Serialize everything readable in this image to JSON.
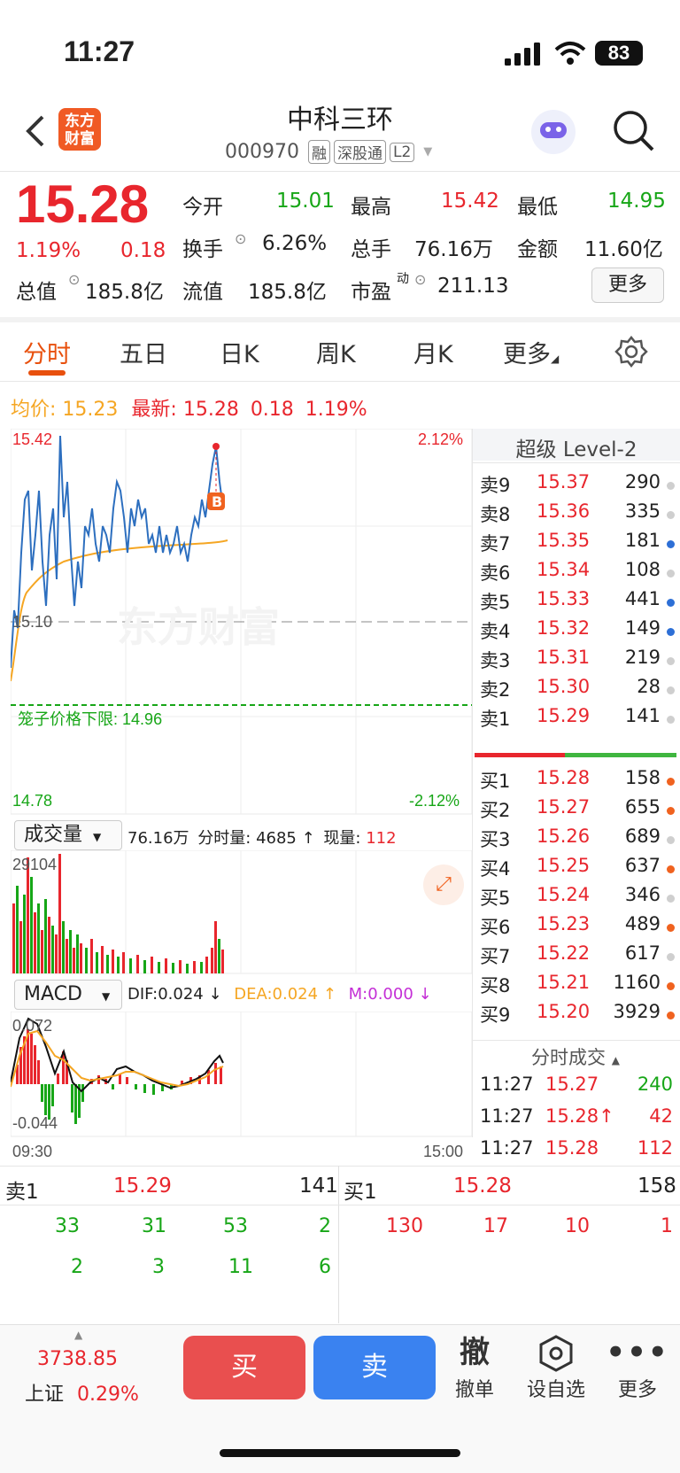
{
  "status": {
    "time": "11:27",
    "battery": "83"
  },
  "header": {
    "title": "中科三环",
    "code": "000970",
    "tags": [
      "融",
      "深股通",
      "L2"
    ],
    "logo": "东方\n财富"
  },
  "quote": {
    "price": "15.28",
    "pct": "1.19%",
    "chg": "0.18",
    "open_label": "今开",
    "open": "15.01",
    "high_label": "最高",
    "high": "15.42",
    "low_label": "最低",
    "low": "14.95",
    "turnover_label": "换手",
    "turnover": "6.26%",
    "volume_label": "总手",
    "volume": "76.16万",
    "amount_label": "金额",
    "amount": "11.60亿",
    "mktcap_label": "总值",
    "mktcap": "185.8亿",
    "float_label": "流值",
    "float": "185.8亿",
    "pe_label": "市盈",
    "pe_sup": "动",
    "pe": "211.13",
    "more": "更多"
  },
  "tabs": [
    "分时",
    "五日",
    "日K",
    "周K",
    "月K",
    "更多"
  ],
  "info": {
    "avg_label": "均价:",
    "avg": "15.23",
    "latest_label": "最新:",
    "latest": "15.28",
    "chg": "0.18",
    "pct": "1.19%"
  },
  "chart": {
    "top_price": "15.42",
    "bottom_price": "14.78",
    "top_pct": "2.12%",
    "bottom_pct": "-2.12%",
    "mid_price": "15.10",
    "watermark": "东方财富",
    "limit_label": "笼子价格下限:",
    "limit_value": "14.96",
    "marker": "B",
    "time_start": "09:30",
    "time_end": "15:00"
  },
  "volume": {
    "selector": "成交量",
    "total": "76.16万",
    "tick_label": "分时量:",
    "tick": "4685",
    "now_label": "现量:",
    "now": "112",
    "max": "29104"
  },
  "macd": {
    "selector": "MACD",
    "dif": "DIF:0.024 ↓",
    "dea": "DEA:0.024 ↑",
    "m": "M:0.000 ↓",
    "top": "0.072",
    "bottom": "-0.044"
  },
  "orderbook": {
    "title": "超级 Level-2",
    "asks": [
      {
        "label": "卖9",
        "price": "15.37",
        "vol": "290",
        "dot": "#cfcfcf"
      },
      {
        "label": "卖8",
        "price": "15.36",
        "vol": "335",
        "dot": "#cfcfcf"
      },
      {
        "label": "卖7",
        "price": "15.35",
        "vol": "181",
        "dot": "#2d6fd6"
      },
      {
        "label": "卖6",
        "price": "15.34",
        "vol": "108",
        "dot": "#cfcfcf"
      },
      {
        "label": "卖5",
        "price": "15.33",
        "vol": "441",
        "dot": "#2d6fd6"
      },
      {
        "label": "卖4",
        "price": "15.32",
        "vol": "149",
        "dot": "#2d6fd6"
      },
      {
        "label": "卖3",
        "price": "15.31",
        "vol": "219",
        "dot": "#cfcfcf"
      },
      {
        "label": "卖2",
        "price": "15.30",
        "vol": "28",
        "dot": "#cfcfcf"
      },
      {
        "label": "卖1",
        "price": "15.29",
        "vol": "141",
        "dot": "#cfcfcf"
      }
    ],
    "bids": [
      {
        "label": "买1",
        "price": "15.28",
        "vol": "158",
        "dot": "#f0621f"
      },
      {
        "label": "买2",
        "price": "15.27",
        "vol": "655",
        "dot": "#f0621f"
      },
      {
        "label": "买3",
        "price": "15.26",
        "vol": "689",
        "dot": "#cfcfcf"
      },
      {
        "label": "买4",
        "price": "15.25",
        "vol": "637",
        "dot": "#f0621f"
      },
      {
        "label": "买5",
        "price": "15.24",
        "vol": "346",
        "dot": "#cfcfcf"
      },
      {
        "label": "买6",
        "price": "15.23",
        "vol": "489",
        "dot": "#f0621f"
      },
      {
        "label": "买7",
        "price": "15.22",
        "vol": "617",
        "dot": "#cfcfcf"
      },
      {
        "label": "买8",
        "price": "15.21",
        "vol": "1160",
        "dot": "#f0621f"
      },
      {
        "label": "买9",
        "price": "15.20",
        "vol": "3929",
        "dot": "#f0621f"
      }
    ],
    "trades_title": "分时成交",
    "trades": [
      {
        "time": "11:27",
        "price": "15.27",
        "vol": "240",
        "color": "green"
      },
      {
        "time": "11:27",
        "price": "15.28↑",
        "vol": "42",
        "color": "red"
      },
      {
        "time": "11:27",
        "price": "15.28",
        "vol": "112",
        "color": "red"
      }
    ]
  },
  "queue": {
    "ask_label": "卖1",
    "ask_price": "15.29",
    "ask_vol": "141",
    "bid_label": "买1",
    "bid_price": "15.28",
    "bid_vol": "158",
    "ask_row1": [
      "33",
      "31",
      "53",
      "2"
    ],
    "ask_row2": [
      "2",
      "3",
      "11",
      "6"
    ],
    "bid_row1": [
      "130",
      "17",
      "10",
      "1"
    ]
  },
  "bottom": {
    "index_value": "3738.85",
    "index_name": "上证",
    "index_pct": "0.29%",
    "buy": "买",
    "sell": "卖",
    "cancel_icon": "撤",
    "cancel": "撤单",
    "watch": "设自选",
    "more": "更多"
  }
}
